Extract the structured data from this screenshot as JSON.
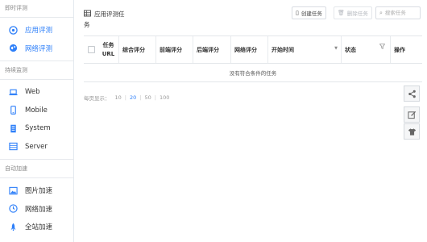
{
  "sidebar": {
    "sections": [
      {
        "title": "即时评测",
        "items": [
          {
            "label": "应用评测",
            "icon": "gauge-icon",
            "active": true
          },
          {
            "label": "网络评测",
            "icon": "globe-icon",
            "active": false
          }
        ]
      },
      {
        "title": "持续监测",
        "items": [
          {
            "label": "Web",
            "icon": "laptop-icon"
          },
          {
            "label": "Mobile",
            "icon": "mobile-icon"
          },
          {
            "label": "System",
            "icon": "server-box-icon"
          },
          {
            "label": "Server",
            "icon": "server-list-icon"
          }
        ]
      },
      {
        "title": "自动加速",
        "items": [
          {
            "label": "图片加速",
            "icon": "image-icon"
          },
          {
            "label": "网络加速",
            "icon": "clock-icon"
          },
          {
            "label": "全站加速",
            "icon": "rocket-icon"
          }
        ]
      }
    ]
  },
  "main": {
    "title": "应用评测任务",
    "title_line1": "应用评测任",
    "title_line2": "务",
    "toolbar": {
      "create_label": "创建任务",
      "delete_label": "删除任务",
      "search_placeholder": "搜索任务"
    },
    "table": {
      "col_task_line1": "任务",
      "col_task_line2": "URL",
      "columns": [
        "综合评分",
        "前端评分",
        "后端评分",
        "网络评分",
        "开始时间",
        "状态",
        "操作"
      ],
      "empty_text": "没有符合条件的任务"
    },
    "pager": {
      "label": "每页显示：",
      "options": [
        "10",
        "20",
        "50",
        "100"
      ],
      "selected": "20"
    }
  },
  "float_tools": [
    "share-icon",
    "edit-icon",
    "shirt-icon"
  ],
  "colors": {
    "accent": "#2d7ff9",
    "border": "#e3e6ea"
  }
}
